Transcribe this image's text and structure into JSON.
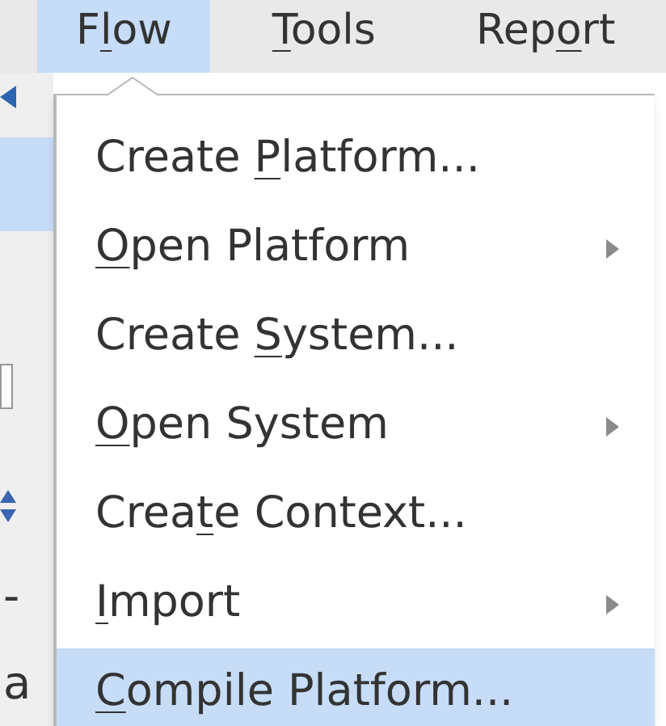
{
  "menu_bar": [
    {
      "label": {
        "before": "F",
        "key": "l",
        "after": "ow"
      },
      "selected": true
    },
    {
      "label": {
        "key": "T",
        "after": "ools"
      },
      "selected": false
    },
    {
      "label": {
        "before": "Rep",
        "key": "o",
        "after": "rt"
      },
      "selected": false
    }
  ],
  "background_texts": [
    "-",
    "a"
  ],
  "menu": [
    {
      "label": {
        "before": "Create ",
        "key": "P",
        "after": "latform..."
      },
      "submenu": false,
      "selected": false
    },
    {
      "label": {
        "key": "O",
        "after": "pen Platform"
      },
      "submenu": true,
      "selected": false
    },
    {
      "label": {
        "before": "Create ",
        "key": "S",
        "after": "ystem..."
      },
      "submenu": false,
      "selected": false
    },
    {
      "label": {
        "key": "O",
        "after": "pen System"
      },
      "submenu": true,
      "selected": false
    },
    {
      "label": {
        "before": "Crea",
        "key": "t",
        "after": "e Context..."
      },
      "submenu": false,
      "selected": false
    },
    {
      "label": {
        "key": "I",
        "after": "mport"
      },
      "submenu": true,
      "selected": false
    },
    {
      "label": {
        "key": "C",
        "after": "ompile Platform..."
      },
      "submenu": false,
      "selected": true
    }
  ]
}
